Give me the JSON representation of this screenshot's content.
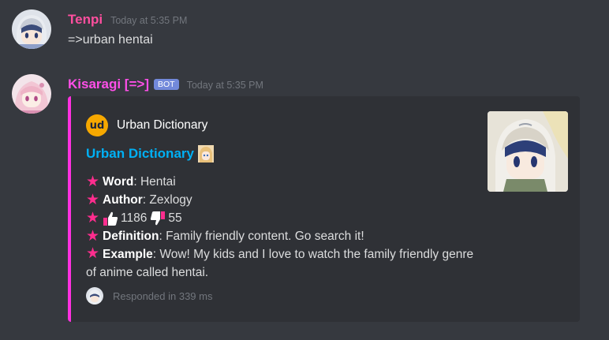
{
  "messages": [
    {
      "username": "Tenpi",
      "username_color": "#ff4f9f",
      "timestamp": "Today at 5:35 PM",
      "content": "=>urban hentai"
    },
    {
      "username": "Kisaragi [=>]",
      "username_color": "#ff4fe8",
      "bot_tag": "BOT",
      "timestamp": "Today at 5:35 PM",
      "embed": {
        "border_color": "#ff30e0",
        "author_icon_text": "ud",
        "author_name": "Urban Dictionary",
        "title": "Urban Dictionary",
        "fields": {
          "word_label": "Word",
          "word_value": ": Hentai",
          "author_label": "Author",
          "author_value": ": Zexlogy",
          "thumbs_up": "1186",
          "thumbs_down": "55",
          "definition_label": "Definition",
          "definition_value": ": Family friendly content. Go search it!",
          "example_label": "Example",
          "example_value": ": Wow! My kids and I love to watch the family friendly genre of anime called hentai."
        },
        "footer_text": "Responded in 339 ms"
      }
    }
  ]
}
